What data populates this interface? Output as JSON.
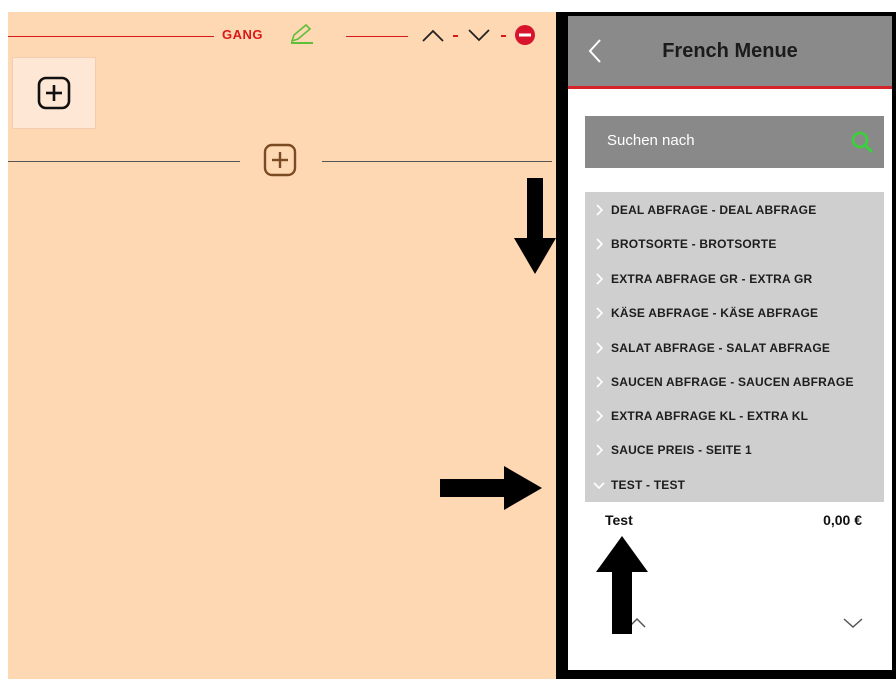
{
  "left_panel": {
    "gang_label": "GANG",
    "colors": {
      "accent_red": "#d81919",
      "edit_green": "#5fbf3a",
      "add_brown": "#7a4a22",
      "background": "#fed7b3"
    },
    "icons": [
      "edit-icon",
      "chevron-up-icon",
      "chevron-down-icon",
      "remove-icon",
      "add-course-icon",
      "add-item-icon"
    ]
  },
  "right_panel": {
    "title": "French Menue",
    "search": {
      "placeholder": "Suchen nach"
    },
    "categories": [
      {
        "label": "DEAL ABFRAGE - DEAL ABFRAGE",
        "expanded": false
      },
      {
        "label": "BROTSORTE - BROTSORTE",
        "expanded": false
      },
      {
        "label": "EXTRA ABFRAGE GR - EXTRA GR",
        "expanded": false
      },
      {
        "label": "KÄSE ABFRAGE - KÄSE ABFRAGE",
        "expanded": false
      },
      {
        "label": "SALAT ABFRAGE - SALAT ABFRAGE",
        "expanded": false
      },
      {
        "label": "SAUCEN ABFRAGE - SAUCEN ABFRAGE",
        "expanded": false
      },
      {
        "label": "EXTRA ABFRAGE KL - EXTRA KL",
        "expanded": false
      },
      {
        "label": "SAUCE PREIS - SEITE 1",
        "expanded": false
      },
      {
        "label": "TEST - TEST",
        "expanded": true
      }
    ],
    "expanded_item": {
      "name": "Test",
      "price": "0,00 €"
    },
    "colors": {
      "header": "#8a8a8a",
      "header_border": "#d6232a",
      "search_icon": "#39d23a",
      "list_bg": "#cfcfcf"
    }
  }
}
